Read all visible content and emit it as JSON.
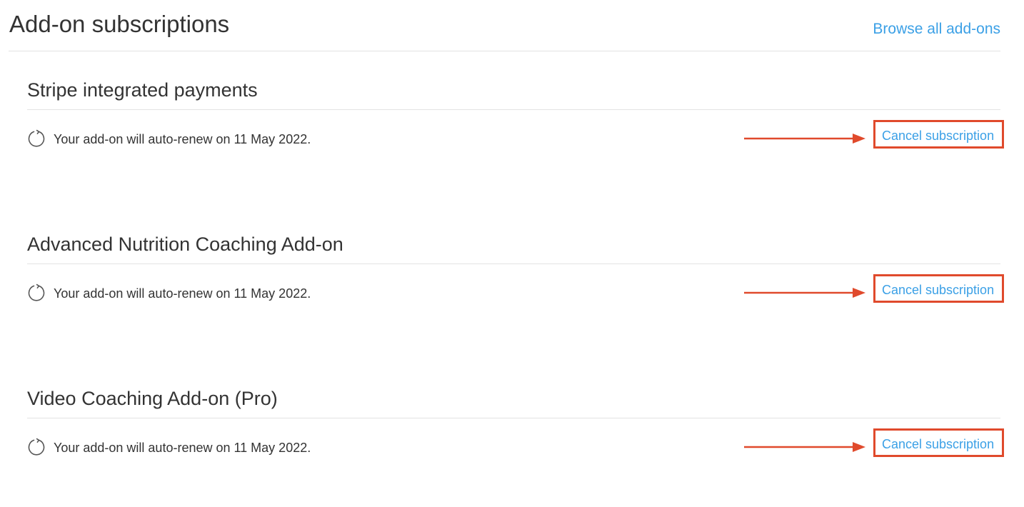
{
  "header": {
    "title": "Add-on subscriptions",
    "browse_link": "Browse all add-ons"
  },
  "addons": [
    {
      "name": "Stripe integrated payments",
      "renew_text": "Your add-on will auto-renew on 11 May 2022.",
      "cancel_label": "Cancel subscription"
    },
    {
      "name": "Advanced Nutrition Coaching Add-on",
      "renew_text": "Your add-on will auto-renew on 11 May 2022.",
      "cancel_label": "Cancel subscription"
    },
    {
      "name": "Video Coaching Add-on (Pro)",
      "renew_text": "Your add-on will auto-renew on 11 May 2022.",
      "cancel_label": "Cancel subscription"
    }
  ],
  "icons": {
    "renew": "refresh-icon",
    "annotation": "arrow-right-icon"
  },
  "colors": {
    "link": "#3ba0e6",
    "annotation": "#e04a2c",
    "text": "#333333",
    "divider": "#e3e3e3"
  }
}
